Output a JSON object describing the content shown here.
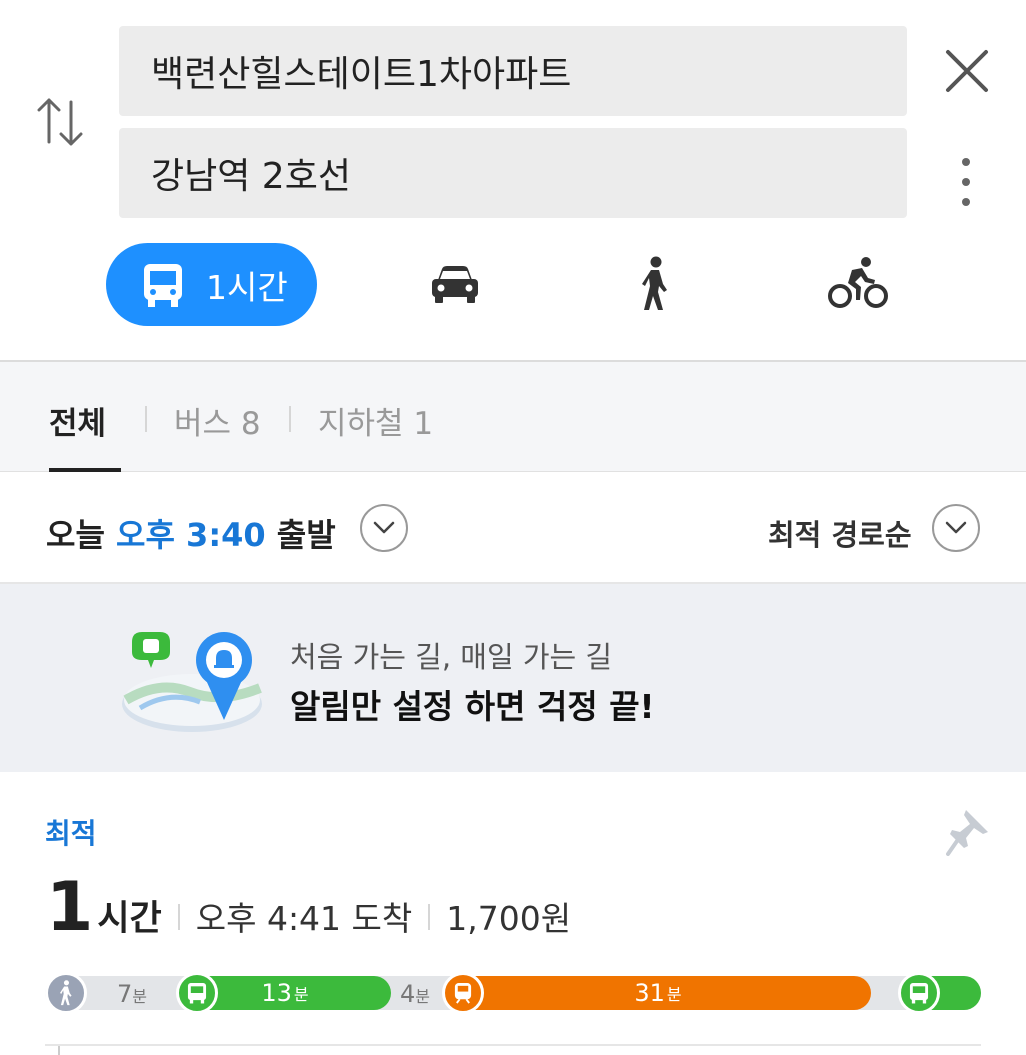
{
  "search": {
    "origin": "백련산힐스테이트1차아파트",
    "destination": "강남역 2호선"
  },
  "modes": {
    "bus_label": "1시간",
    "active_color": "#1e90ff",
    "icons": [
      "bus-icon",
      "car-icon",
      "walk-icon",
      "bike-icon"
    ]
  },
  "tabs": {
    "all": "전체",
    "bus": "버스 8",
    "subway": "지하철 1"
  },
  "depart": {
    "prefix": "오늘",
    "time": "오후 3:40",
    "suffix": "출발",
    "sort": "최적 경로순"
  },
  "banner": {
    "line1": "처음 가는 길, 매일 가는 길",
    "line2": "알림만 설정 하면 걱정 끝!"
  },
  "route": {
    "tag": "최적",
    "duration_num": "1",
    "duration_unit": "시간",
    "arrival": "오후 4:41 도착",
    "fare": "1,700원",
    "segments": {
      "walk1": "7",
      "bus1": "13",
      "walk2": "4",
      "subway": "31",
      "unit": "분"
    },
    "colors": {
      "bus": "#3cba3c",
      "subway": "#f07400",
      "walk": "#9aa3b5"
    }
  }
}
